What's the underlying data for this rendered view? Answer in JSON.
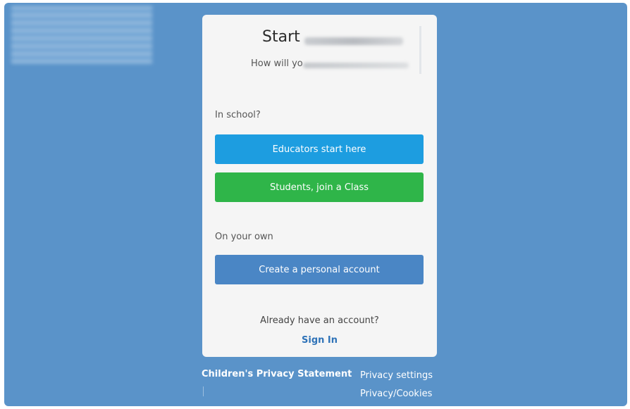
{
  "card": {
    "title": "Start",
    "subtitle": "How will yo",
    "in_school_label": "In school?",
    "educators_button": "Educators start here",
    "students_button": "Students, join a Class",
    "on_your_own_label": "On your own",
    "personal_button": "Create a personal account",
    "already_text": "Already have an account?",
    "sign_in": "Sign In"
  },
  "footer": {
    "children_privacy": "Children's Privacy Statement",
    "privacy_settings": "Privacy settings",
    "privacy_cookies": "Privacy/Cookies"
  },
  "colors": {
    "background": "#5a93c9",
    "educators": "#1d9de0",
    "students": "#2fb549",
    "personal": "#4a86c5",
    "link": "#2f73b8"
  }
}
